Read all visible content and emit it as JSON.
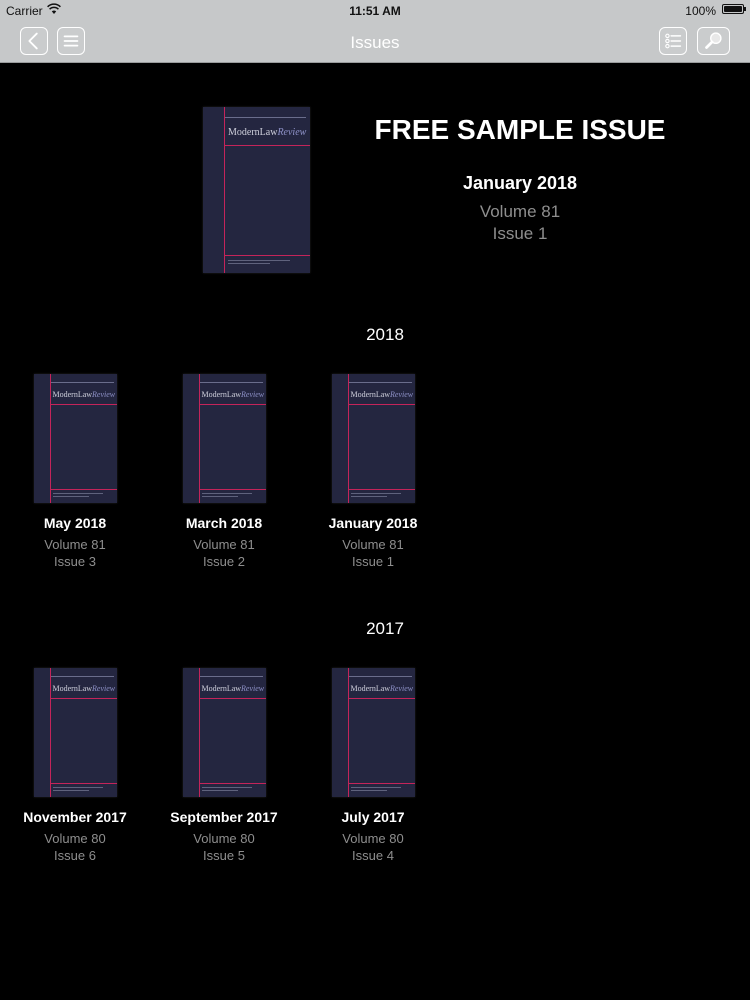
{
  "status_bar": {
    "carrier": "Carrier",
    "time": "11:51 AM",
    "battery": "100%"
  },
  "navbar": {
    "title": "Issues"
  },
  "featured": {
    "heading": "FREE SAMPLE ISSUE",
    "date": "January 2018",
    "volume": "Volume 81",
    "issue": "Issue 1"
  },
  "sections": [
    {
      "year": "2018",
      "issues": [
        {
          "date": "May 2018",
          "volume": "Volume 81",
          "issue": "Issue 3"
        },
        {
          "date": "March 2018",
          "volume": "Volume 81",
          "issue": "Issue 2"
        },
        {
          "date": "January 2018",
          "volume": "Volume 81",
          "issue": "Issue 1"
        }
      ]
    },
    {
      "year": "2017",
      "issues": [
        {
          "date": "November 2017",
          "volume": "Volume 80",
          "issue": "Issue 6"
        },
        {
          "date": "September 2017",
          "volume": "Volume 80",
          "issue": "Issue 5"
        },
        {
          "date": "July 2017",
          "volume": "Volume 80",
          "issue": "Issue 4"
        }
      ]
    }
  ],
  "cover": {
    "masthead_main": "ModernLaw",
    "masthead_italic": "Review",
    "background": "#242640",
    "accent": "#c4245a"
  },
  "colors": {
    "nav_background": "#c6c8c9",
    "page_background": "#000000",
    "secondary_text": "#8e8e8e"
  },
  "icons": {
    "back": "chevron-left-icon",
    "menu": "hamburger-menu-icon",
    "list": "list-view-icon",
    "search": "magnifier-icon"
  }
}
